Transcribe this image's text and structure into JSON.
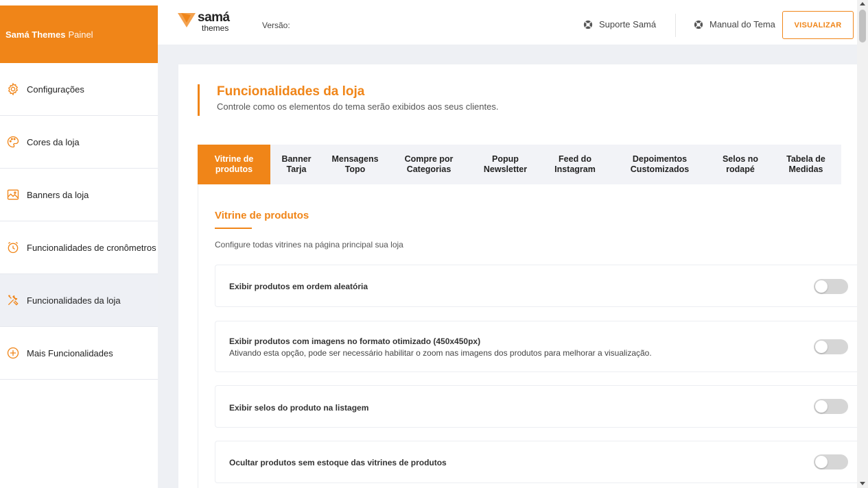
{
  "sidebar": {
    "brand_bold": "Samá Themes",
    "brand_rest": "Painel",
    "items": [
      {
        "label": "Configurações",
        "icon": "gear-icon"
      },
      {
        "label": "Cores da loja",
        "icon": "palette-icon"
      },
      {
        "label": "Banners da loja",
        "icon": "image-icon"
      },
      {
        "label": "Funcionalidades de cronômetros",
        "icon": "alarm-clock-icon"
      },
      {
        "label": "Funcionalidades da loja",
        "icon": "tools-icon"
      },
      {
        "label": "Mais Funcionalidades",
        "icon": "plus-circle-icon"
      }
    ],
    "active_index": 4
  },
  "header": {
    "logo_line1": "samá",
    "logo_line2": "themes",
    "version_label": "Versão:",
    "support_label": "Suporte Samá",
    "manual_label": "Manual do Tema",
    "view_button": "VISUALIZAR"
  },
  "main": {
    "title": "Funcionalidades da loja",
    "subtitle": "Controle como os elementos do tema serão exibidos aos seus clientes.",
    "tabs": [
      {
        "l1": "Vitrine de",
        "l2": "produtos"
      },
      {
        "l1": "Banner",
        "l2": "Tarja"
      },
      {
        "l1": "Mensagens",
        "l2": "Topo"
      },
      {
        "l1": "Compre por",
        "l2": "Categorias"
      },
      {
        "l1": "Popup",
        "l2": "Newsletter"
      },
      {
        "l1": "Feed do",
        "l2": "Instagram"
      },
      {
        "l1": "Depoimentos",
        "l2": "Customizados"
      },
      {
        "l1": "Selos no",
        "l2": "rodapé"
      },
      {
        "l1": "Tabela de",
        "l2": "Medidas"
      }
    ],
    "active_tab": 0,
    "section": {
      "title": "Vitrine de produtos",
      "description": "Configure todas vitrines na página principal sua loja"
    },
    "options": [
      {
        "label": "Exibir produtos em ordem aleatória",
        "note": "",
        "enabled": false
      },
      {
        "label": "Exibir produtos com imagens no formato otimizado (450x450px)",
        "note": "Ativando esta opção, pode ser necessário habilitar o zoom nas imagens dos produtos para melhorar a visualização.",
        "enabled": false
      },
      {
        "label": "Exibir selos do produto na listagem",
        "note": "",
        "enabled": false
      },
      {
        "label": "Ocultar produtos sem estoque das vitrines de produtos",
        "note": "",
        "enabled": false
      }
    ]
  },
  "colors": {
    "accent": "#f08518",
    "sidebar_active": "#eef0f5",
    "toggle_off": "#d6d6d6"
  }
}
